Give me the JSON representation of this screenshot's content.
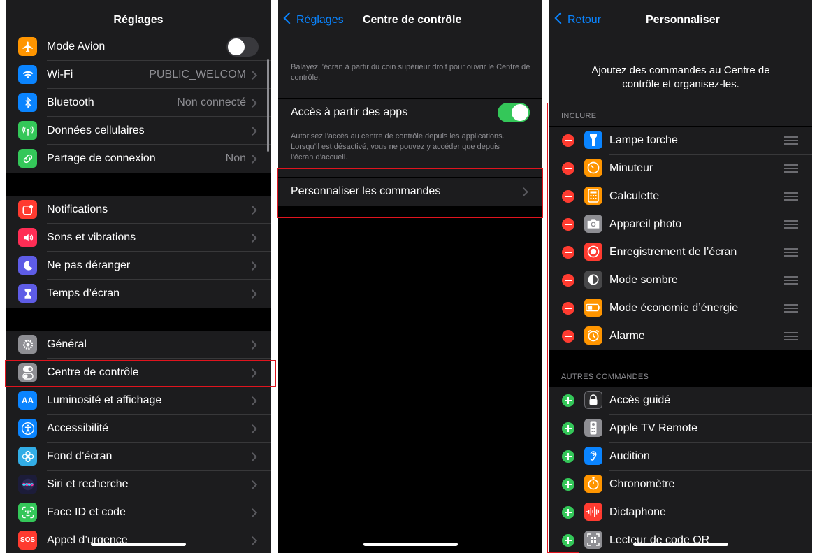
{
  "screen1": {
    "title": "Réglages",
    "group1": [
      {
        "label": "Mode Avion",
        "icon": "airplane-icon",
        "color": "#ff9500",
        "toggle": "off"
      },
      {
        "label": "Wi-Fi",
        "value": "PUBLIC_WELCOM",
        "icon": "wifi-icon",
        "color": "#0a84ff"
      },
      {
        "label": "Bluetooth",
        "value": "Non connecté",
        "icon": "bluetooth-icon",
        "color": "#0a84ff"
      },
      {
        "label": "Données cellulaires",
        "icon": "antenna-icon",
        "color": "#34c759"
      },
      {
        "label": "Partage de connexion",
        "value": "Non",
        "icon": "link-icon",
        "color": "#34c759"
      }
    ],
    "group2": [
      {
        "label": "Notifications",
        "icon": "notifications-icon",
        "color": "#ff3b30"
      },
      {
        "label": "Sons et vibrations",
        "icon": "speaker-icon",
        "color": "#ff2d55"
      },
      {
        "label": "Ne pas déranger",
        "icon": "moon-icon",
        "color": "#5e5ce6"
      },
      {
        "label": "Temps d’écran",
        "icon": "hourglass-icon",
        "color": "#5e5ce6"
      }
    ],
    "group3": [
      {
        "label": "Général",
        "icon": "gear-icon",
        "color": "#8e8e93"
      },
      {
        "label": "Centre de contrôle",
        "icon": "switches-icon",
        "color": "#8e8e93"
      },
      {
        "label": "Luminosité et affichage",
        "icon": "text-size-icon",
        "color": "#0a84ff",
        "glyph": "AA"
      },
      {
        "label": "Accessibilité",
        "icon": "accessibility-icon",
        "color": "#0a84ff"
      },
      {
        "label": "Fond d’écran",
        "icon": "flower-icon",
        "color": "#32ade6"
      },
      {
        "label": "Siri et recherche",
        "icon": "siri-icon",
        "color": "#1c1c3a"
      },
      {
        "label": "Face ID et code",
        "icon": "face-id-icon",
        "color": "#34c759"
      },
      {
        "label": "Appel d’urgence",
        "icon": "sos-icon",
        "color": "#ff3b30",
        "glyph": "SOS"
      }
    ]
  },
  "screen2": {
    "back": "Réglages",
    "title": "Centre de contrôle",
    "intro": "Balayez l’écran à partir du coin supérieur droit pour ouvrir le Centre de contrôle.",
    "access_label": "Accès à partir des apps",
    "access_toggle": "on",
    "access_note": "Autorisez l’accès au centre de contrôle depuis les applications. Lorsqu’il est désactivé, vous ne pouvez y accéder que depuis l’écran d’accueil.",
    "customize_label": "Personnaliser les commandes"
  },
  "screen3": {
    "back": "Retour",
    "title": "Personnaliser",
    "intro": "Ajoutez des commandes au Centre de contrôle et organisez-les.",
    "include_header": "INCLURE",
    "included": [
      {
        "label": "Lampe torche",
        "icon": "flashlight-icon",
        "color": "#0a84ff"
      },
      {
        "label": "Minuteur",
        "icon": "timer-icon",
        "color": "#ff9500"
      },
      {
        "label": "Calculette",
        "icon": "calculator-icon",
        "color": "#ff9500"
      },
      {
        "label": "Appareil photo",
        "icon": "camera-icon",
        "color": "#8e8e93"
      },
      {
        "label": "Enregistrement de l’écran",
        "icon": "record-icon",
        "color": "#ff3b30"
      },
      {
        "label": "Mode sombre",
        "icon": "dark-mode-icon",
        "color": "#48484a"
      },
      {
        "label": "Mode économie d’énergie",
        "icon": "battery-icon",
        "color": "#ff9500"
      },
      {
        "label": "Alarme",
        "icon": "alarm-icon",
        "color": "#ff9500"
      }
    ],
    "other_header": "AUTRES COMMANDES",
    "others": [
      {
        "label": "Accès guidé",
        "icon": "lock-icon",
        "color": "#2c2c2e"
      },
      {
        "label": "Apple TV Remote",
        "icon": "remote-icon",
        "color": "#8e8e93"
      },
      {
        "label": "Audition",
        "icon": "ear-icon",
        "color": "#0a84ff"
      },
      {
        "label": "Chronomètre",
        "icon": "stopwatch-icon",
        "color": "#ff9500"
      },
      {
        "label": "Dictaphone",
        "icon": "waveform-icon",
        "color": "#ff3b30"
      },
      {
        "label": "Lecteur de code QR",
        "icon": "qr-code-icon",
        "color": "#8e8e93"
      }
    ]
  }
}
